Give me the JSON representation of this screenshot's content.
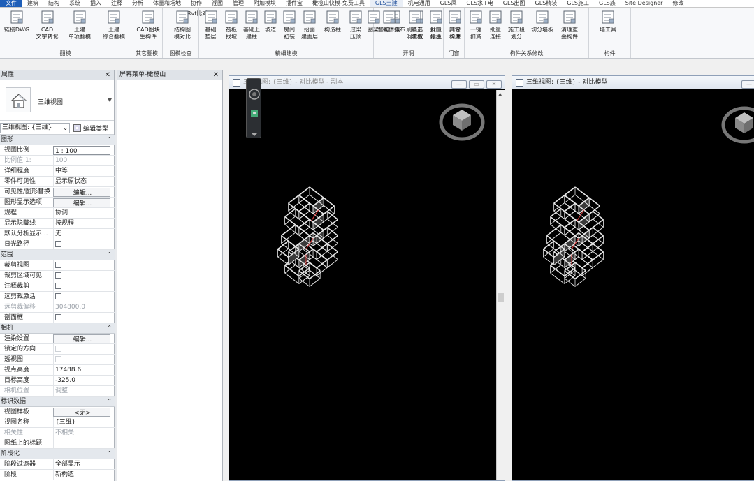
{
  "menubar": {
    "items": [
      "文件",
      "建筑",
      "结构",
      "系统",
      "插入",
      "注释",
      "分析",
      "体量和场地",
      "协作",
      "视图",
      "管理",
      "附加模块",
      "插件宝",
      "橄榄山快模-免费工具",
      "GLS土建",
      "机电通用",
      "GLS风",
      "GLS水+电",
      "GLS出图",
      "GLS精装",
      "GLS施工",
      "GLS族",
      "Site Designer",
      "修改"
    ],
    "active": "GLS土建"
  },
  "ribbon": {
    "rvt_compare": "Rvt比对",
    "groups": [
      {
        "label": "翻模",
        "buttons": [
          [
            "链接DWG",
            ""
          ],
          [
            "CAD",
            "文字转化"
          ],
          [
            "土建",
            "单项翻模"
          ],
          [
            "土建",
            "综合翻模"
          ]
        ]
      },
      {
        "label": "其它翻模",
        "buttons": [
          [
            "CAD图块",
            "生构件"
          ]
        ]
      },
      {
        "label": "图模检查",
        "buttons": [
          [
            "结构图",
            "模对比"
          ]
        ]
      },
      {
        "label": "精细建模",
        "buttons": [
          [
            "基础",
            "垫层"
          ],
          [
            "筏板",
            "找坡"
          ],
          [
            "基础上",
            "建柱"
          ],
          [
            "坡道",
            ""
          ],
          [
            "房间",
            "初装"
          ],
          [
            "抬面",
            "建面层"
          ],
          [
            "构造柱",
            ""
          ],
          [
            "过梁",
            "压顶"
          ],
          [
            "圈梁",
            ""
          ],
          [
            "砌体排布",
            ""
          ],
          [
            "点选",
            "建板"
          ],
          [
            "批量",
            "建板"
          ],
          [
            "其它",
            "构件"
          ]
        ]
      },
      {
        "label": "开洞",
        "buttons": [
          [
            "智能开洞",
            ""
          ],
          [
            "刷新开",
            "洞位置"
          ],
          [
            "洞口",
            "标注"
          ]
        ]
      },
      {
        "label": "门窗",
        "buttons": [
          [
            "门垛",
            "长度"
          ]
        ]
      },
      {
        "label": "构件关系修改",
        "buttons": [
          [
            "一键",
            "扣减"
          ],
          [
            "批量",
            "连接"
          ],
          [
            "施工段",
            "划分"
          ],
          [
            "切分墙板",
            ""
          ],
          [
            "清理重",
            "叠构件"
          ]
        ]
      },
      {
        "label": "构件",
        "buttons": [
          [
            "墙工具",
            ""
          ]
        ]
      }
    ]
  },
  "properties": {
    "title": "属性",
    "type_name": "三维视图",
    "view_selector": "三维视图: {三维}",
    "edit_type": "编辑类型",
    "sections": [
      {
        "name": "图形",
        "rows": [
          {
            "k": "视图比例",
            "v": "1 : 100",
            "kind": "box"
          },
          {
            "k": "比例值 1:",
            "v": "100",
            "kind": "dim"
          },
          {
            "k": "详细程度",
            "v": "中等"
          },
          {
            "k": "零件可见性",
            "v": "显示原状态"
          },
          {
            "k": "可见性/图形替换",
            "v": "编辑...",
            "kind": "btn"
          },
          {
            "k": "图形显示选项",
            "v": "编辑...",
            "kind": "btn"
          },
          {
            "k": "规程",
            "v": "协调"
          },
          {
            "k": "显示隐藏线",
            "v": "按规程"
          },
          {
            "k": "默认分析显示...",
            "v": "无"
          },
          {
            "k": "日光路径",
            "v": "",
            "kind": "cb"
          }
        ]
      },
      {
        "name": "范围",
        "rows": [
          {
            "k": "裁剪视图",
            "v": "",
            "kind": "cb"
          },
          {
            "k": "裁剪区域可见",
            "v": "",
            "kind": "cb"
          },
          {
            "k": "注释裁剪",
            "v": "",
            "kind": "cb"
          },
          {
            "k": "远剪裁激活",
            "v": "",
            "kind": "cb"
          },
          {
            "k": "远剪裁偏移",
            "v": "304800.0",
            "kind": "dim"
          },
          {
            "k": "剖面框",
            "v": "",
            "kind": "cb"
          }
        ]
      },
      {
        "name": "相机",
        "rows": [
          {
            "k": "渲染设置",
            "v": "编辑...",
            "kind": "btn"
          },
          {
            "k": "锁定的方向",
            "v": "",
            "kind": "cbdim"
          },
          {
            "k": "透视图",
            "v": "",
            "kind": "cbdim"
          },
          {
            "k": "视点高度",
            "v": "17488.6"
          },
          {
            "k": "目标高度",
            "v": "-325.0"
          },
          {
            "k": "相机位置",
            "v": "调整",
            "kind": "dim"
          }
        ]
      },
      {
        "name": "标识数据",
        "rows": [
          {
            "k": "视图样板",
            "v": "<无>",
            "kind": "btn"
          },
          {
            "k": "视图名称",
            "v": "{三维}"
          },
          {
            "k": "相关性",
            "v": "不相关",
            "kind": "dim"
          },
          {
            "k": "图纸上的标题",
            "v": ""
          }
        ]
      },
      {
        "name": "阶段化",
        "rows": [
          {
            "k": "阶段过滤器",
            "v": "全部显示"
          },
          {
            "k": "阶段",
            "v": "新构造"
          }
        ]
      }
    ]
  },
  "browser": {
    "title": "屏幕菜单-橄榄山"
  },
  "views": [
    {
      "title": "三维视图: {三维} - 对比模型 - 副本",
      "active": false
    },
    {
      "title": "三维视图: {三维} - 对比模型",
      "active": true
    }
  ],
  "colors": {
    "accent": "#1e5eb8",
    "canvas": "#000000",
    "walls": "#e6e6e6",
    "highlight": "#d23c3c"
  }
}
